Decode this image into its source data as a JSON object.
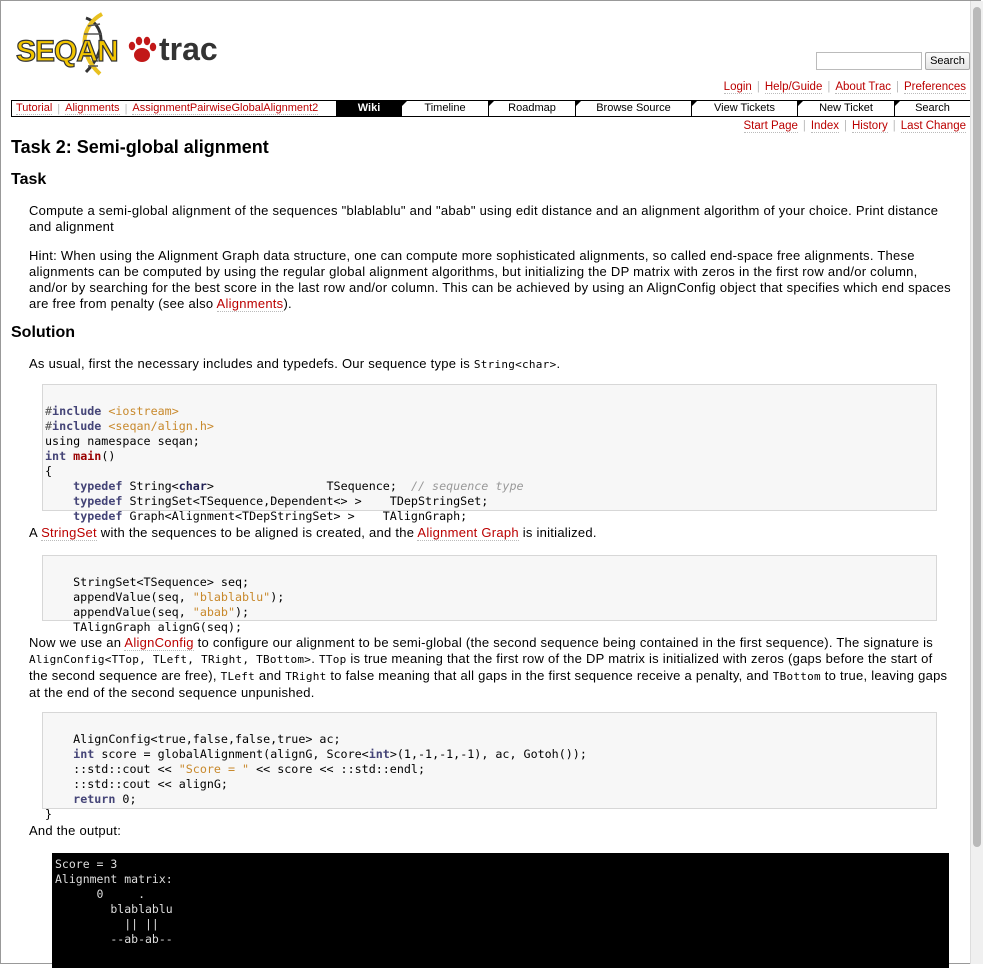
{
  "logo": {
    "text_left": "SEQAN",
    "text_right": "trac"
  },
  "search": {
    "input_value": "",
    "button_label": "Search"
  },
  "metanav": [
    "Login",
    "Help/Guide",
    "About Trac",
    "Preferences"
  ],
  "breadcrumb": [
    "Tutorial",
    "Alignments",
    "AssignmentPairwiseGlobalAlignment2"
  ],
  "mainnav": [
    {
      "label": "Wiki",
      "active": true
    },
    {
      "label": "Timeline",
      "active": false
    },
    {
      "label": "Roadmap",
      "active": false
    },
    {
      "label": "Browse Source",
      "active": false
    },
    {
      "label": "View Tickets",
      "active": false
    },
    {
      "label": "New Ticket",
      "active": false
    },
    {
      "label": "Search",
      "active": false
    }
  ],
  "ctxtnav": [
    "Start Page",
    "Index",
    "History",
    "Last Change"
  ],
  "page": {
    "title": "Task 2: Semi-global alignment",
    "h_task": "Task",
    "task_text": "Compute a semi-global alignment of the sequences \"blablablu\" and \"abab\" using edit distance and an alignment algorithm of your choice. Print distance and alignment",
    "hint_text": "Hint: When using the Alignment Graph data structure, one can compute more sophisticated alignments, so called end-space free alignments. These alignments can be computed by using the regular global alignment algorithms, but initializing the DP matrix with zeros in the first row and/or column, and/or by searching for the best score in the last row and/or column. This can be achieved by using an AlignConfig object that specifies which end spaces are free from penalty (see also ",
    "hint_link": "Alignments",
    "hint_end": ").",
    "h_solution": "Solution",
    "sol1_text": "As usual, first the necessary includes and typedefs. Our sequence type is ",
    "sol1_code": "String<char>",
    "sol1_end": ".",
    "sol2_a": "A ",
    "sol2_link1": "StringSet",
    "sol2_b": " with the sequences to be aligned is created, and the ",
    "sol2_link2": "Alignment Graph",
    "sol2_c": " is initialized.",
    "sol3_a": "Now we use an ",
    "sol3_link": "AlignConfig",
    "sol3_b": " to configure our alignment to be semi-global (the second sequence being contained in the first sequence). The signature is ",
    "sol3_code1": "AlignConfig<TTop, TLeft, TRight, TBottom>",
    "sol3_c": ". ",
    "sol3_code2": "TTop",
    "sol3_d": " is true meaning that the first row of the DP matrix is initialized with zeros (gaps before the start of the second sequence are free), ",
    "sol3_code3": "TLeft",
    "sol3_e": " and ",
    "sol3_code4": "TRight",
    "sol3_f": " to false meaning that all gaps in the first sequence receive a penalty, and ",
    "sol3_code5": "TBottom",
    "sol3_g": " to true, leaving gaps at the end of the second sequence unpunished.",
    "output_label": "And the output:"
  },
  "code1": [
    "#include <iostream>",
    "#include <seqan/align.h>",
    "using namespace seqan;",
    "int main()",
    "{",
    "    typedef String<char>                TSequence;  // sequence type",
    "    typedef StringSet<TSequence,Dependent<> >    TDepStringSet;",
    "    typedef Graph<Alignment<TDepStringSet> >    TAlignGraph;"
  ],
  "code2": [
    "    StringSet<TSequence> seq;",
    "    appendValue(seq, \"blablablu\");",
    "    appendValue(seq, \"abab\");",
    "    TAlignGraph alignG(seq);"
  ],
  "code3": [
    "    AlignConfig<true,false,false,true> ac;",
    "    int score = globalAlignment(alignG, Score<int>(1,-1,-1,-1), ac, Gotoh());",
    "    ::std::cout << \"Score = \" << score << ::std::endl;",
    "    ::std::cout << alignG;",
    "    return 0;",
    "}"
  ],
  "output": [
    "Score = 3",
    "Alignment matrix:",
    "      0     .",
    "        blablablu",
    "          || ||",
    "        --ab-ab--"
  ]
}
